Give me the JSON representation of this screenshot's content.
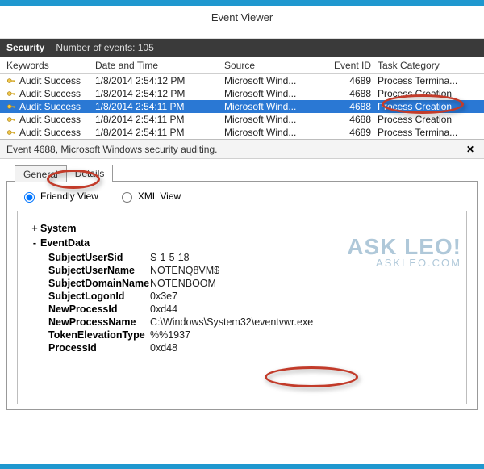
{
  "window": {
    "title": "Event Viewer"
  },
  "log_bar": {
    "name": "Security",
    "count_label": "Number of events: 105"
  },
  "columns": {
    "keywords": "Keywords",
    "datetime": "Date and Time",
    "source": "Source",
    "event_id": "Event ID",
    "task_category": "Task Category"
  },
  "rows": [
    {
      "keywords": "Audit Success",
      "datetime": "1/8/2014 2:54:12 PM",
      "source": "Microsoft Wind...",
      "event_id": "4689",
      "task": "Process Termina..."
    },
    {
      "keywords": "Audit Success",
      "datetime": "1/8/2014 2:54:12 PM",
      "source": "Microsoft Wind...",
      "event_id": "4688",
      "task": "Process Creation"
    },
    {
      "keywords": "Audit Success",
      "datetime": "1/8/2014 2:54:11 PM",
      "source": "Microsoft Wind...",
      "event_id": "4688",
      "task": "Process Creation",
      "selected": true
    },
    {
      "keywords": "Audit Success",
      "datetime": "1/8/2014 2:54:11 PM",
      "source": "Microsoft Wind...",
      "event_id": "4688",
      "task": "Process Creation"
    },
    {
      "keywords": "Audit Success",
      "datetime": "1/8/2014 2:54:11 PM",
      "source": "Microsoft Wind...",
      "event_id": "4689",
      "task": "Process Termina..."
    }
  ],
  "detail_header": "Event 4688, Microsoft Windows security auditing.",
  "tabs": {
    "general": "General",
    "details": "Details"
  },
  "view_radios": {
    "friendly": "Friendly View",
    "xml": "XML View"
  },
  "friendly": {
    "system_label": "System",
    "eventdata_label": "EventData",
    "fields": [
      {
        "label": "SubjectUserSid",
        "value": "S-1-5-18"
      },
      {
        "label": "SubjectUserName",
        "value": "NOTENQ8VM$"
      },
      {
        "label": "SubjectDomainName",
        "value": "NOTENBOOM"
      },
      {
        "label": "SubjectLogonId",
        "value": "0x3e7"
      },
      {
        "label": "NewProcessId",
        "value": "0xd44"
      },
      {
        "label": "NewProcessName",
        "value": "C:\\Windows\\System32\\eventvwr.exe"
      },
      {
        "label": "TokenElevationType",
        "value": "%%1937"
      },
      {
        "label": "ProcessId",
        "value": "0xd48"
      }
    ]
  },
  "watermark": {
    "line1": "ASK LEO!",
    "line2": "ASKLEO.COM"
  }
}
